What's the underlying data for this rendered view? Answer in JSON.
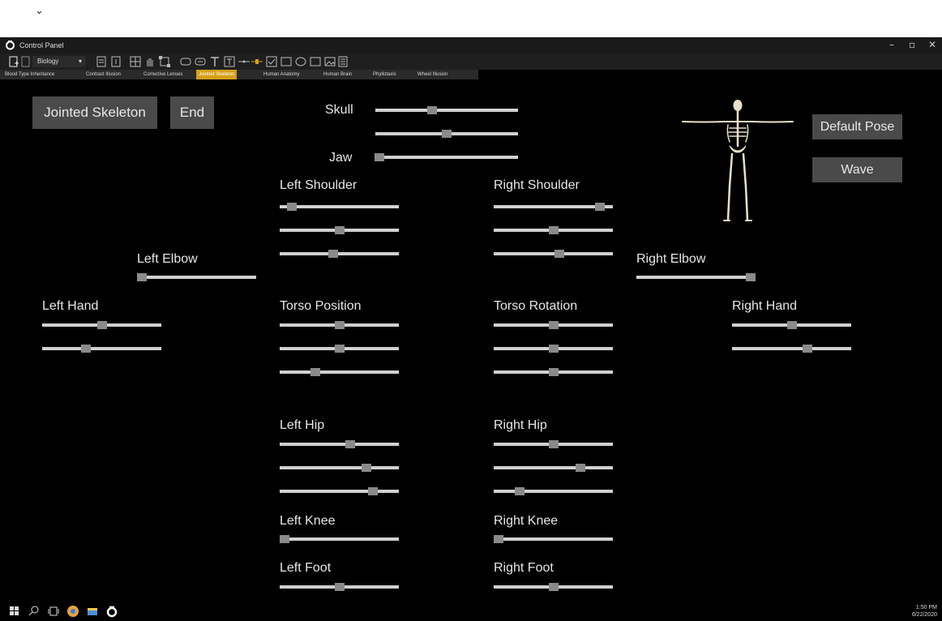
{
  "top": {
    "chevron": "⌄"
  },
  "window": {
    "title": "Control Panel",
    "controls": {
      "minimize": "–",
      "maximize": "▫",
      "close": "✕"
    }
  },
  "toolbar": {
    "subject": "Biology",
    "subject_chevron": "▾"
  },
  "tabs": [
    {
      "label": "Blood Type Inheritance",
      "active": false
    },
    {
      "label": "Contrast Illusion",
      "active": false
    },
    {
      "label": "Corrective Lenses",
      "active": false
    },
    {
      "label": "Jointed Skeleton",
      "active": true
    },
    {
      "label": "Human Anatomy",
      "active": false
    },
    {
      "label": "Human Brain",
      "active": false
    },
    {
      "label": "Phyllotaxis",
      "active": false
    },
    {
      "label": "Wheel Illusion",
      "active": false
    }
  ],
  "buttons": {
    "jointed_skeleton": "Jointed Skeleton",
    "end": "End",
    "default_pose": "Default Pose",
    "wave": "Wave"
  },
  "labels": {
    "skull": "Skull",
    "jaw": "Jaw",
    "left_shoulder": "Left Shoulder",
    "right_shoulder": "Right Shoulder",
    "left_elbow": "Left Elbow",
    "right_elbow": "Right Elbow",
    "left_hand": "Left Hand",
    "torso_position": "Torso Position",
    "torso_rotation": "Torso Rotation",
    "right_hand": "Right Hand",
    "left_hip": "Left Hip",
    "right_hip": "Right Hip",
    "left_knee": "Left Knee",
    "right_knee": "Right Knee",
    "left_foot": "Left Foot",
    "right_foot": "Right Foot"
  },
  "slider_values": {
    "skull": [
      0.4,
      0.5
    ],
    "jaw": [
      0.03
    ],
    "left_shoulder": [
      0.1,
      0.5,
      0.45
    ],
    "right_shoulder": [
      0.89,
      0.5,
      0.55
    ],
    "left_elbow": [
      0.04
    ],
    "right_elbow": [
      0.96
    ],
    "left_hand": [
      0.5,
      0.37
    ],
    "torso_position": [
      0.5,
      0.5,
      0.3
    ],
    "torso_rotation": [
      0.5,
      0.5,
      0.5
    ],
    "right_hand": [
      0.5,
      0.63
    ],
    "left_hip": [
      0.59,
      0.73,
      0.78
    ],
    "right_hip": [
      0.5,
      0.73,
      0.22
    ],
    "left_knee": [
      0.04
    ],
    "right_knee": [
      0.04
    ],
    "left_foot": [
      0.5
    ],
    "right_foot": [
      0.5
    ]
  },
  "taskbar": {
    "time": "1:50 PM",
    "date": "6/22/2020"
  },
  "colors": {
    "background": "#000000",
    "button": "#4a4a4a",
    "active_tab": "#d4a017",
    "slider_track": "#d0d0d0",
    "slider_thumb": "#8a8a8a"
  }
}
